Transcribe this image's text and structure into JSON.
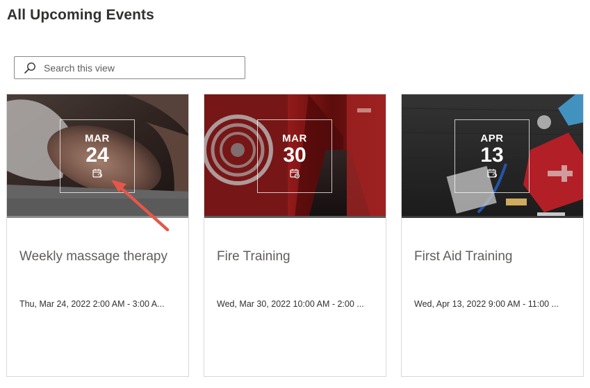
{
  "page": {
    "title": "All Upcoming Events"
  },
  "search": {
    "placeholder": "Search this view",
    "value": "",
    "icon": "search-icon"
  },
  "events": [
    {
      "month": "MAR",
      "day": "24",
      "title": "Weekly massage therapy",
      "datetime": "Thu, Mar 24, 2022 2:00 AM - 3:00 A...",
      "icon": "recurring-calendar-icon",
      "image": "massage-photo",
      "accent": "#6b6b6b"
    },
    {
      "month": "MAR",
      "day": "30",
      "title": "Fire Training",
      "datetime": "Wed, Mar 30, 2022 10:00 AM - 2:00 ...",
      "icon": "calendar-clock-icon",
      "image": "fire-hose-corridor-photo",
      "accent": "#5b5b5b"
    },
    {
      "month": "APR",
      "day": "13",
      "title": "First Aid Training",
      "datetime": "Wed, Apr 13, 2022 9:00 AM - 11:00 ...",
      "icon": "recurring-calendar-icon",
      "image": "first-aid-kit-photo",
      "accent": "#3a3a3a"
    }
  ],
  "colors": {
    "annotation_arrow": "#e5574a",
    "text_primary": "#323130",
    "text_secondary": "#605e5c",
    "card_border": "#d8d8d8"
  }
}
